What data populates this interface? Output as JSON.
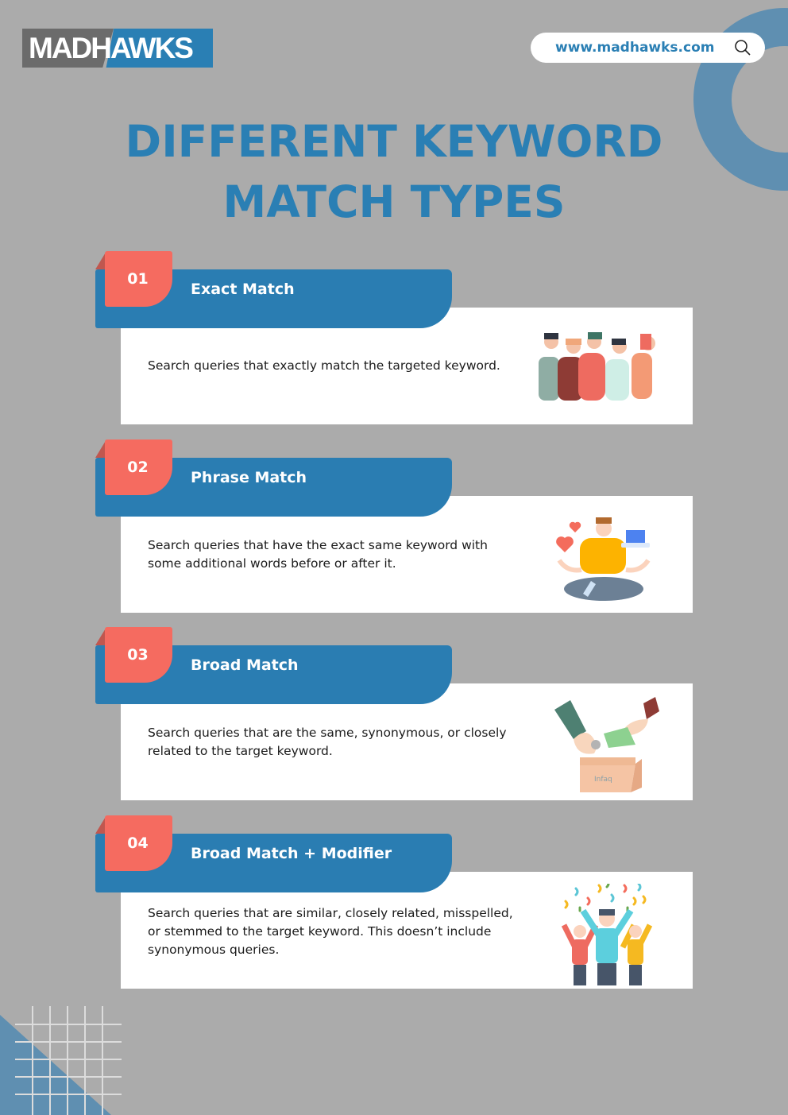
{
  "brand": {
    "logo_text": "MADHAWKS",
    "colors": {
      "primary_blue": "#2a7fb4",
      "coral": "#f56b60",
      "grey_bg": "#ababab",
      "logo_grey": "#6b6b6b"
    }
  },
  "search": {
    "url_text": "www.madhawks.com",
    "icon": "search-icon"
  },
  "title": {
    "line1": "DIFFERENT KEYWORD",
    "line2": "MATCH TYPES"
  },
  "items": [
    {
      "number": "01",
      "heading": "Exact Match",
      "description": "Search queries that exactly match the targeted keyword.",
      "illustration": "group-of-people-talking-illustration"
    },
    {
      "number": "02",
      "heading": "Phrase Match",
      "description": "Search queries that have the exact same keyword with some additional words before or after it.",
      "illustration": "meditating-person-with-hearts-and-laptop-illustration"
    },
    {
      "number": "03",
      "heading": "Broad Match",
      "description": "Search queries that are the same, synonymous, or closely related to the target keyword.",
      "illustration": "hands-donating-into-box-illustration",
      "box_label": "Infaq"
    },
    {
      "number": "04",
      "heading": "Broad Match + Modifier",
      "description": "Search queries that are similar, closely related, misspelled, or stemmed to the target keyword. This doesn’t include synonymous queries.",
      "illustration": "celebrating-people-confetti-illustration"
    }
  ]
}
